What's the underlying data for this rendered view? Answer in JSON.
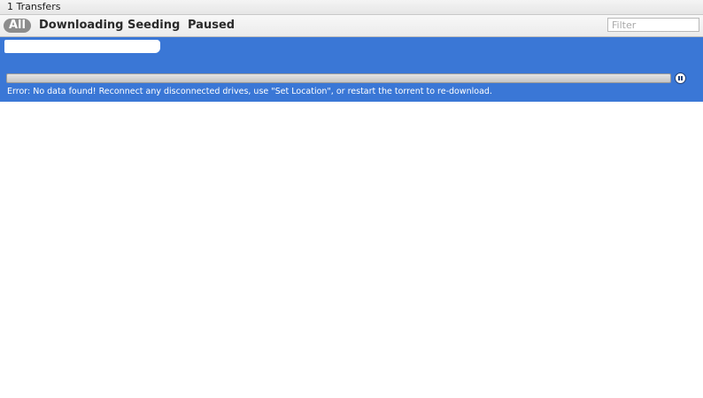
{
  "window": {
    "title": "1 Transfers"
  },
  "filter_bar": {
    "tabs": [
      {
        "label": "All",
        "active": true
      },
      {
        "label": "Downloading",
        "active": false
      },
      {
        "label": "Seeding",
        "active": false
      },
      {
        "label": "Paused",
        "active": false
      }
    ],
    "filter_placeholder": "Filter",
    "filter_value": ""
  },
  "torrents": [
    {
      "name": "",
      "progress_percent": 0,
      "state": "error",
      "status": "Error: No data found! Reconnect any disconnected drives, use \"Set Location\", or restart the torrent to re-download.",
      "action_icon": "pause-icon"
    }
  ],
  "colors": {
    "selection": "#3a77d6",
    "active_tab_bg": "#8c8c8c"
  }
}
